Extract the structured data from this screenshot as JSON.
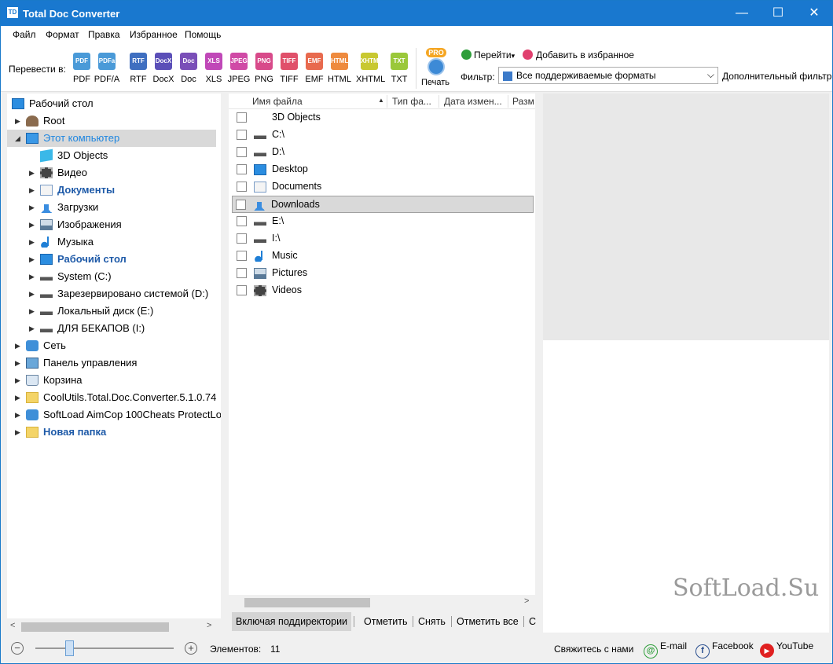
{
  "window": {
    "title": "Total Doc Converter",
    "minimize": "—",
    "maximize": "☐",
    "close": "✕"
  },
  "menu": [
    "Файл",
    "Формат",
    "Правка",
    "Избранное",
    "Помощь"
  ],
  "toolbar": {
    "convert_label": "Перевести в:",
    "formats": [
      {
        "icon": "PDF",
        "label": "PDF",
        "color": "#4a9ad8"
      },
      {
        "icon": "PDFa",
        "label": "PDF/A",
        "color": "#4a9ad8"
      },
      {
        "icon": "RTF",
        "label": "RTF",
        "color": "#3f6fc0"
      },
      {
        "icon": "DocX",
        "label": "DocX",
        "color": "#5b4fb8"
      },
      {
        "icon": "Doc",
        "label": "Doc",
        "color": "#7a4fb8"
      },
      {
        "icon": "XLS",
        "label": "XLS",
        "color": "#c048b8"
      },
      {
        "icon": "JPEG",
        "label": "JPEG",
        "color": "#d04aa6"
      },
      {
        "icon": "PNG",
        "label": "PNG",
        "color": "#d84a8a"
      },
      {
        "icon": "TIFF",
        "label": "TIFF",
        "color": "#e0506a"
      },
      {
        "icon": "EMF",
        "label": "EMF",
        "color": "#e86a4e"
      },
      {
        "icon": "HTML",
        "label": "HTML",
        "color": "#ee8a3e"
      },
      {
        "icon": "XHTML",
        "label": "XHTML",
        "color": "#c8c830"
      },
      {
        "icon": "TXT",
        "label": "TXT",
        "color": "#9ac83a"
      }
    ],
    "pro_badge": "PRO",
    "print_label": "Печать",
    "goto_label": "Перейти",
    "goto_chevron": "▾",
    "favorite_label": "Добавить в избранное",
    "filter_label": "Фильтр:",
    "filter_value": "Все поддерживаемые форматы",
    "filter_chevron": "⌵",
    "extra_filter": "Дополнительный фильтр"
  },
  "tree": [
    {
      "label": "Рабочий стол",
      "icon": "desktop-icon",
      "indent": 0,
      "arrow": "",
      "style": ""
    },
    {
      "label": "Root",
      "icon": "user-icon",
      "indent": 1,
      "arrow": "▶",
      "style": ""
    },
    {
      "label": "Этот компьютер",
      "icon": "computer-icon",
      "indent": 1,
      "arrow": "◢",
      "style": "selc"
    },
    {
      "label": "3D Objects",
      "icon": "cube-icon",
      "indent": 2,
      "arrow": "",
      "style": ""
    },
    {
      "label": "Видео",
      "icon": "film-icon",
      "indent": 2,
      "arrow": "▶",
      "style": ""
    },
    {
      "label": "Документы",
      "icon": "document-icon",
      "indent": 2,
      "arrow": "▶",
      "style": "bold"
    },
    {
      "label": "Загрузки",
      "icon": "download-icon",
      "indent": 2,
      "arrow": "▶",
      "style": ""
    },
    {
      "label": "Изображения",
      "icon": "picture-icon",
      "indent": 2,
      "arrow": "▶",
      "style": ""
    },
    {
      "label": "Музыка",
      "icon": "music-icon",
      "indent": 2,
      "arrow": "▶",
      "style": ""
    },
    {
      "label": "Рабочий стол",
      "icon": "desktop-icon",
      "indent": 2,
      "arrow": "▶",
      "style": "bold"
    },
    {
      "label": "System (C:)",
      "icon": "drive-icon",
      "indent": 2,
      "arrow": "▶",
      "style": ""
    },
    {
      "label": "Зарезервировано системой (D:)",
      "icon": "drive-icon",
      "indent": 2,
      "arrow": "▶",
      "style": ""
    },
    {
      "label": "Локальный диск (E:)",
      "icon": "drive-icon",
      "indent": 2,
      "arrow": "▶",
      "style": ""
    },
    {
      "label": "ДЛЯ БЕКАПОВ (I:)",
      "icon": "drive-icon",
      "indent": 2,
      "arrow": "▶",
      "style": ""
    },
    {
      "label": "Сеть",
      "icon": "network-icon",
      "indent": 1,
      "arrow": "▶",
      "style": ""
    },
    {
      "label": "Панель управления",
      "icon": "control-panel-icon",
      "indent": 1,
      "arrow": "▶",
      "style": ""
    },
    {
      "label": "Корзина",
      "icon": "recycle-bin-icon",
      "indent": 1,
      "arrow": "▶",
      "style": ""
    },
    {
      "label": "CoolUtils.Total.Doc.Converter.5.1.0.74",
      "icon": "folder-icon",
      "indent": 1,
      "arrow": "▶",
      "style": ""
    },
    {
      "label": "SoftLoad AimCop 100Cheats ProtectLo",
      "icon": "network-icon",
      "indent": 1,
      "arrow": "▶",
      "style": ""
    },
    {
      "label": "Новая папка",
      "icon": "folder-icon",
      "indent": 1,
      "arrow": "▶",
      "style": "bold"
    }
  ],
  "list": {
    "columns": [
      "Имя файла",
      "Тип фа...",
      "Дата измен...",
      "Разм"
    ],
    "sort_arrow": "▲",
    "rows": [
      {
        "name": "3D Objects",
        "icon": "cube-icon"
      },
      {
        "name": "C:\\",
        "icon": "drive-icon"
      },
      {
        "name": "D:\\",
        "icon": "drive-icon"
      },
      {
        "name": "Desktop",
        "icon": "desktop-icon"
      },
      {
        "name": "Documents",
        "icon": "document-icon"
      },
      {
        "name": "Downloads",
        "icon": "download-icon"
      },
      {
        "name": "E:\\",
        "icon": "drive-icon"
      },
      {
        "name": "I:\\",
        "icon": "drive-icon"
      },
      {
        "name": "Music",
        "icon": "music-icon"
      },
      {
        "name": "Pictures",
        "icon": "picture-icon"
      },
      {
        "name": "Videos",
        "icon": "film-icon"
      }
    ],
    "selected_index": 5
  },
  "bottom_buttons": [
    "Включая поддиректории",
    "Отметить",
    "Снять",
    "Отметить все",
    "С"
  ],
  "status": {
    "elements_label": "Элементов:",
    "elements_count": "11",
    "zoom_minus": "−",
    "zoom_plus": "+",
    "contact_label": "Свяжитесь с нами",
    "email": "E-mail",
    "facebook": "Facebook",
    "youtube": "YouTube"
  },
  "scroll": {
    "left": "<",
    "right": ">"
  },
  "watermark": "SoftLoad.Su",
  "colors": {
    "titlebar": "#1978cf",
    "accent": "#1e86e0",
    "selection": "#d9d9d9"
  }
}
